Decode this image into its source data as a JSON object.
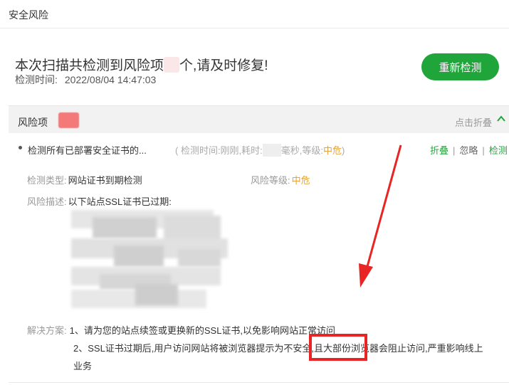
{
  "topbar": {
    "title": "安全风险"
  },
  "summary": {
    "prefix": "本次扫描共检测到风险项",
    "suffix": "个,请及时修复!",
    "detect_time_label": "检测时间:",
    "detect_time_value": "2022/08/04 14:47:03"
  },
  "rescan_button": {
    "label": "重新检测"
  },
  "risk_header": {
    "label": "风险项",
    "collapse_label": "点击折叠"
  },
  "risk_item": {
    "name": "检测所有已部署安全证书的...",
    "meta_prefix": "( 检测时间:刚刚,耗时:",
    "meta_middle": "毫秒,等级:",
    "level": "中危",
    "meta_suffix": ")",
    "actions": [
      "折叠",
      "忽略",
      "检测"
    ]
  },
  "detail": {
    "type_label": "检测类型:",
    "type_value": "网站证书到期检测",
    "risk_level_label": "风险等级:",
    "risk_level_value": "中危",
    "desc_label": "风险描述:",
    "desc_value": "以下站点SSL证书已过期:",
    "solution_label": "解决方案:",
    "solution_1": "1、请为您的站点续签或更换新的SSL证书,以免影响网站正常访问",
    "solution_2": "2、SSL证书过期后,用户访问网站将被浏览器提示为不安全,且大部份浏览器会阻止访问,严重影响线上",
    "solution_2_cont": "业务"
  },
  "colors": {
    "brand_green": "#20a53a",
    "warning_orange": "#e6a23c",
    "annotation_red": "#e82424"
  },
  "icons": {
    "collapse": "chevron-up-icon"
  }
}
